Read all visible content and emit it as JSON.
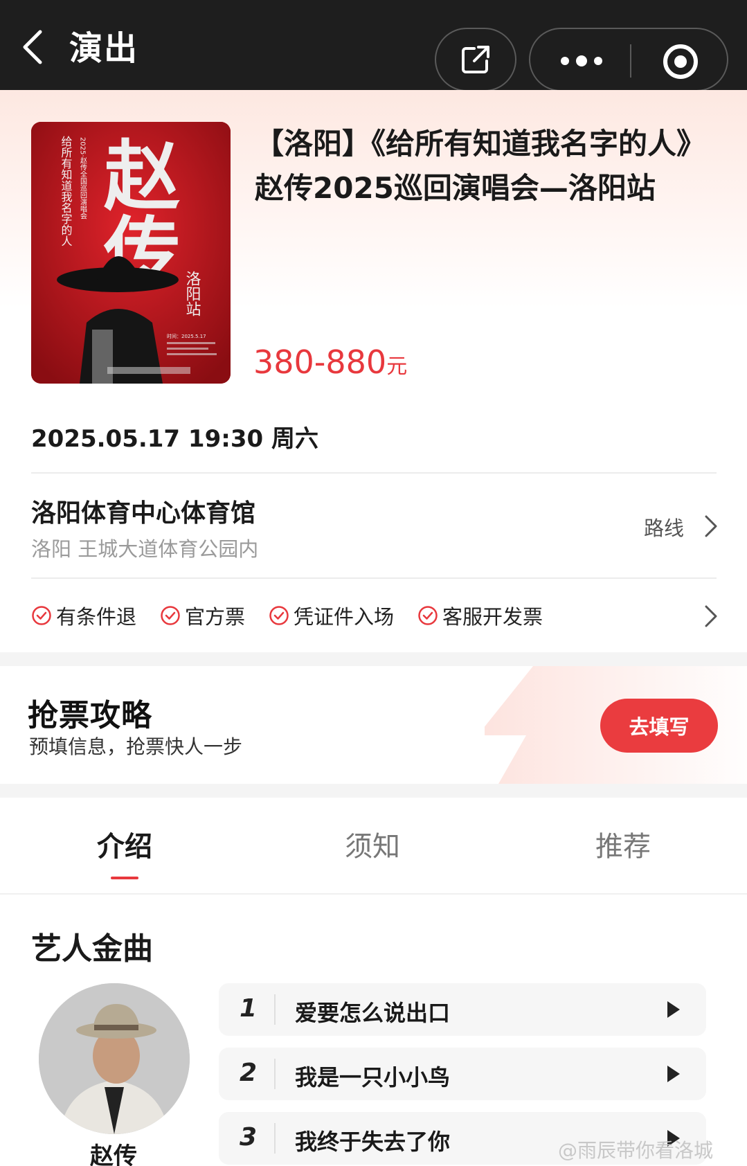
{
  "nav": {
    "title": "演出",
    "share_icon": "share-icon",
    "more_icon": "more-icon",
    "record_icon": "record-icon"
  },
  "show": {
    "title": "【洛阳】《给所有知道我名字的人》赵传2025巡回演唱会—洛阳站",
    "price_range": "380-880",
    "price_unit": "元",
    "poster": {
      "big_name": "赵传",
      "side_text": "给所有知道我名字的人",
      "tour_text": "2025·赵传全国巡回演唱会",
      "station": "洛阳站",
      "info_line": "时间：2025.5.17",
      "accent_color": "#b8141a"
    }
  },
  "schedule": {
    "datetime": "2025.05.17 19:30 周六"
  },
  "venue": {
    "name": "洛阳体育中心体育馆",
    "address": "洛阳 王城大道体育公园内",
    "route_label": "路线"
  },
  "tags": [
    "有条件退",
    "官方票",
    "凭证件入场",
    "客服开发票"
  ],
  "promo": {
    "title": "抢票攻略",
    "subtitle": "预填信息，抢票快人一步",
    "button": "去填写"
  },
  "tabs": [
    {
      "label": "介绍",
      "active": true
    },
    {
      "label": "须知",
      "active": false
    },
    {
      "label": "推荐",
      "active": false
    }
  ],
  "songs_section": {
    "title": "艺人金曲",
    "artist": "赵传",
    "songs": [
      {
        "num": "1",
        "name": "爱要怎么说出口"
      },
      {
        "num": "2",
        "name": "我是一只小小鸟"
      },
      {
        "num": "3",
        "name": "我终于失去了你"
      }
    ]
  },
  "watermark": "@雨辰带你看洛城",
  "colors": {
    "accent": "#e8383d",
    "nav_bg": "#1e1e1e"
  }
}
